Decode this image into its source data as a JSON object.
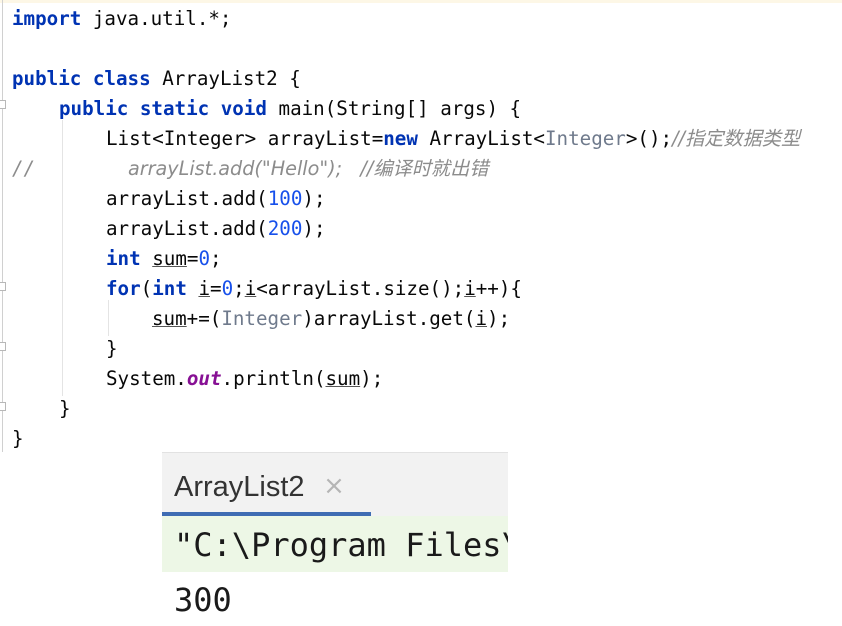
{
  "editor": {
    "line1": {
      "kw": "import",
      "rest": " java.util.*;"
    },
    "line3": {
      "kw1": "public",
      "kw2": "class",
      "rest": " ArrayList2 {"
    },
    "line4": {
      "kw1": "public",
      "kw2": "static",
      "kw3": "void",
      "rest": " main(String[] args) {"
    },
    "line5": {
      "a": "List<Integer> arrayList=",
      "kw": "new",
      "b": " ArrayList<",
      "gen": "Integer",
      "c": ">();",
      "cmt": "//指定数据类型"
    },
    "line6": {
      "cmt1": "//",
      "cmt2": "arrayList.add(\"Hello\");   //编译时就出错"
    },
    "line7": {
      "a": "arrayList.add(",
      "num": "100",
      "b": ");"
    },
    "line8": {
      "a": "arrayList.add(",
      "num": "200",
      "b": ");"
    },
    "line9": {
      "kw": "int",
      "var": "sum",
      "eq": "=",
      "num": "0",
      "semi": ";"
    },
    "line10": {
      "kw": "for",
      "p1": "(",
      "kw2": "int",
      "i1": "i",
      "eq": "=",
      "num": "0",
      "s1": ";",
      "i2": "i",
      "mid": "<arrayList.size();",
      "i3": "i",
      "end": "++){"
    },
    "line11": {
      "var": "sum",
      "a": "+=(",
      "gen": "Integer",
      "b": ")arrayList.get(",
      "i": "i",
      "c": ");"
    },
    "line12": {
      "text": "}"
    },
    "line13": {
      "a": "System.",
      "fld": "out",
      "b": ".println(",
      "var": "sum",
      "c": ");"
    },
    "line14": {
      "text": "}"
    },
    "line15": {
      "text": "}"
    }
  },
  "run": {
    "tab_label": "ArrayList2",
    "close_glyph": "×",
    "command_text": "\"C:\\Program Files\\Java\\jdk\\bin\\java.exe\"",
    "output_text": "300"
  },
  "colors": {
    "keyword": "#0033b3",
    "number": "#1750eb",
    "comment": "#8c8c8c",
    "static_field": "#871094",
    "run_tab_underline": "#3f6cb3",
    "command_background": "#edf7e6"
  }
}
